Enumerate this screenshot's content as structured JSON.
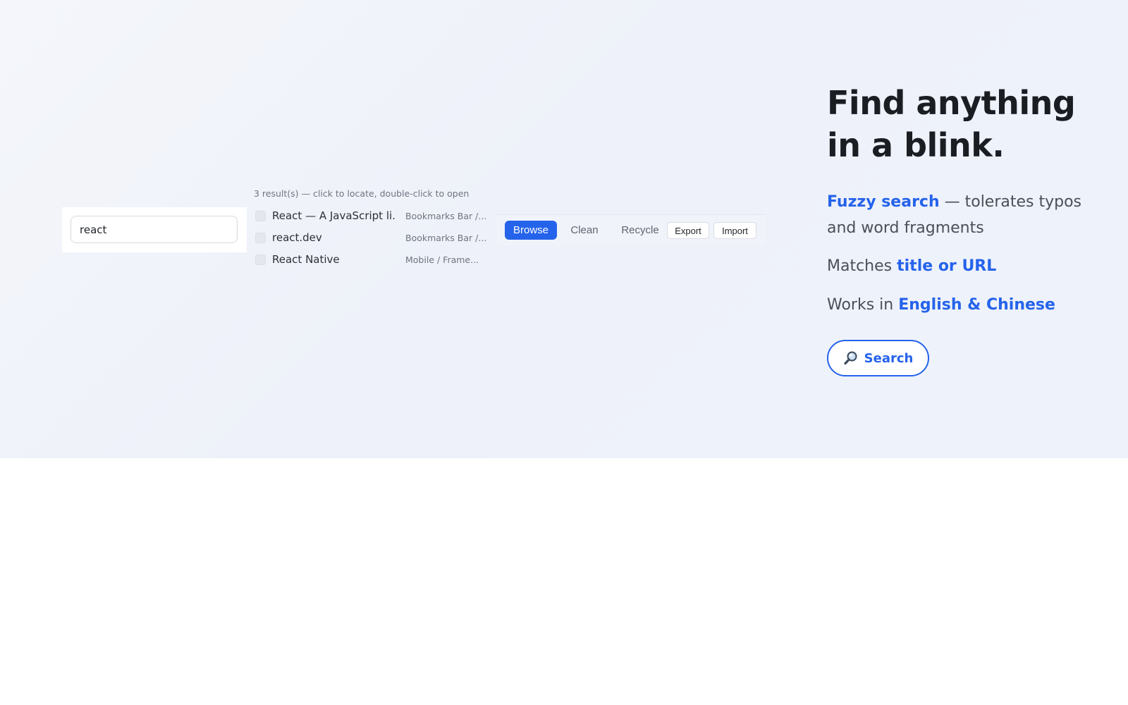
{
  "search": {
    "value": "react"
  },
  "results": {
    "summary": "3 result(s) — click to locate, double-click to open",
    "items": [
      {
        "title": "React — A JavaScript li...",
        "path": "Bookmarks Bar /..."
      },
      {
        "title": "react.dev",
        "path": "Bookmarks Bar /..."
      },
      {
        "title": "React Native",
        "path": "Mobile / Frame..."
      }
    ]
  },
  "toolbar": {
    "browse": "Browse",
    "clean": "Clean",
    "recycle": "Recycle",
    "export": "Export",
    "import": "Import"
  },
  "hero": {
    "headline_line1": "Find anything",
    "headline_line2": "in a blink.",
    "feature1_highlight": "Fuzzy search",
    "feature1_rest": " — tolerates typos and word fragments",
    "feature2_prefix": "Matches ",
    "feature2_highlight": "title or URL",
    "feature3_prefix": "Works in ",
    "feature3_highlight": "English & Chinese",
    "cta_label": "Search",
    "cta_icon": "magnifier-icon"
  },
  "colors": {
    "accent": "#2563eb",
    "hero_bg": "#eef1f9"
  }
}
